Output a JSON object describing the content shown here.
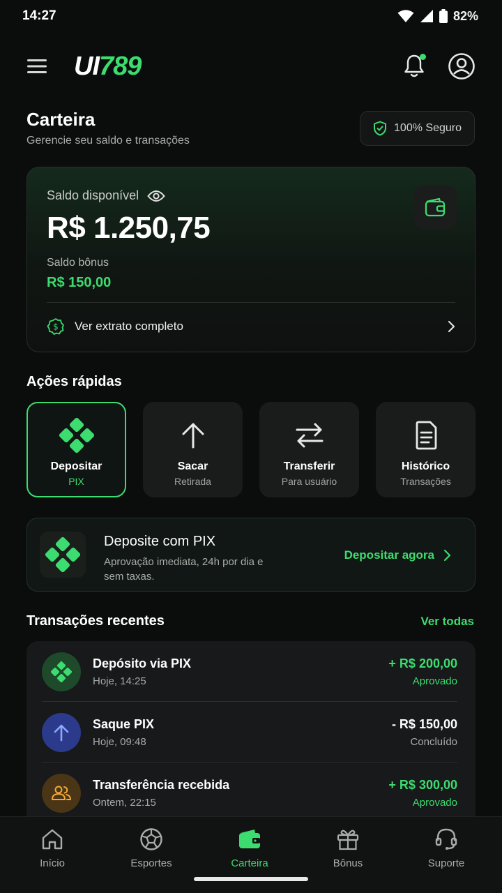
{
  "status_bar": {
    "time": "14:27",
    "battery": "82%"
  },
  "header": {
    "logo_white": "UI",
    "logo_green": "789"
  },
  "page": {
    "title": "Carteira",
    "subtitle": "Gerencie seu saldo e transações",
    "secure_badge": "100% Seguro"
  },
  "balance": {
    "label": "Saldo disponível",
    "amount": "R$ 1.250,75",
    "bonus_label": "Saldo bônus",
    "bonus_amount": "R$ 150,00",
    "statement_link": "Ver extrato completo"
  },
  "quick_actions": {
    "title": "Ações rápidas",
    "items": [
      {
        "label": "Depositar",
        "sub": "PIX"
      },
      {
        "label": "Sacar",
        "sub": "Retirada"
      },
      {
        "label": "Transferir",
        "sub": "Para usuário"
      },
      {
        "label": "Histórico",
        "sub": "Transações"
      }
    ]
  },
  "pix_banner": {
    "title": "Deposite com PIX",
    "description": "Aprovação imediata, 24h por dia e sem taxas.",
    "cta": "Depositar agora"
  },
  "transactions": {
    "title": "Transações recentes",
    "see_all": "Ver todas",
    "items": [
      {
        "name": "Depósito via PIX",
        "date": "Hoje, 14:25",
        "amount": "+ R$ 200,00",
        "status": "Aprovado",
        "amount_color": "#3ddc70",
        "status_color": "#3ddc70",
        "icon": "pix-icon"
      },
      {
        "name": "Saque PIX",
        "date": "Hoje, 09:48",
        "amount": "- R$ 150,00",
        "status": "Concluído",
        "amount_color": "#ffffff",
        "status_color": "#a6aba8",
        "icon": "arrow-up-icon"
      },
      {
        "name": "Transferência recebida",
        "date": "Ontem, 22:15",
        "amount": "+ R$ 300,00",
        "status": "Aprovado",
        "amount_color": "#3ddc70",
        "status_color": "#3ddc70",
        "icon": "users-icon"
      }
    ]
  },
  "bottom_nav": {
    "items": [
      {
        "label": "Início",
        "icon": "home-icon"
      },
      {
        "label": "Esportes",
        "icon": "soccer-ball-icon"
      },
      {
        "label": "Carteira",
        "icon": "wallet-icon",
        "active": true
      },
      {
        "label": "Bônus",
        "icon": "gift-icon"
      },
      {
        "label": "Suporte",
        "icon": "headset-icon"
      }
    ]
  },
  "colors": {
    "accent": "#3ddc70",
    "background": "#0b0c0c",
    "card": "#17191a"
  }
}
